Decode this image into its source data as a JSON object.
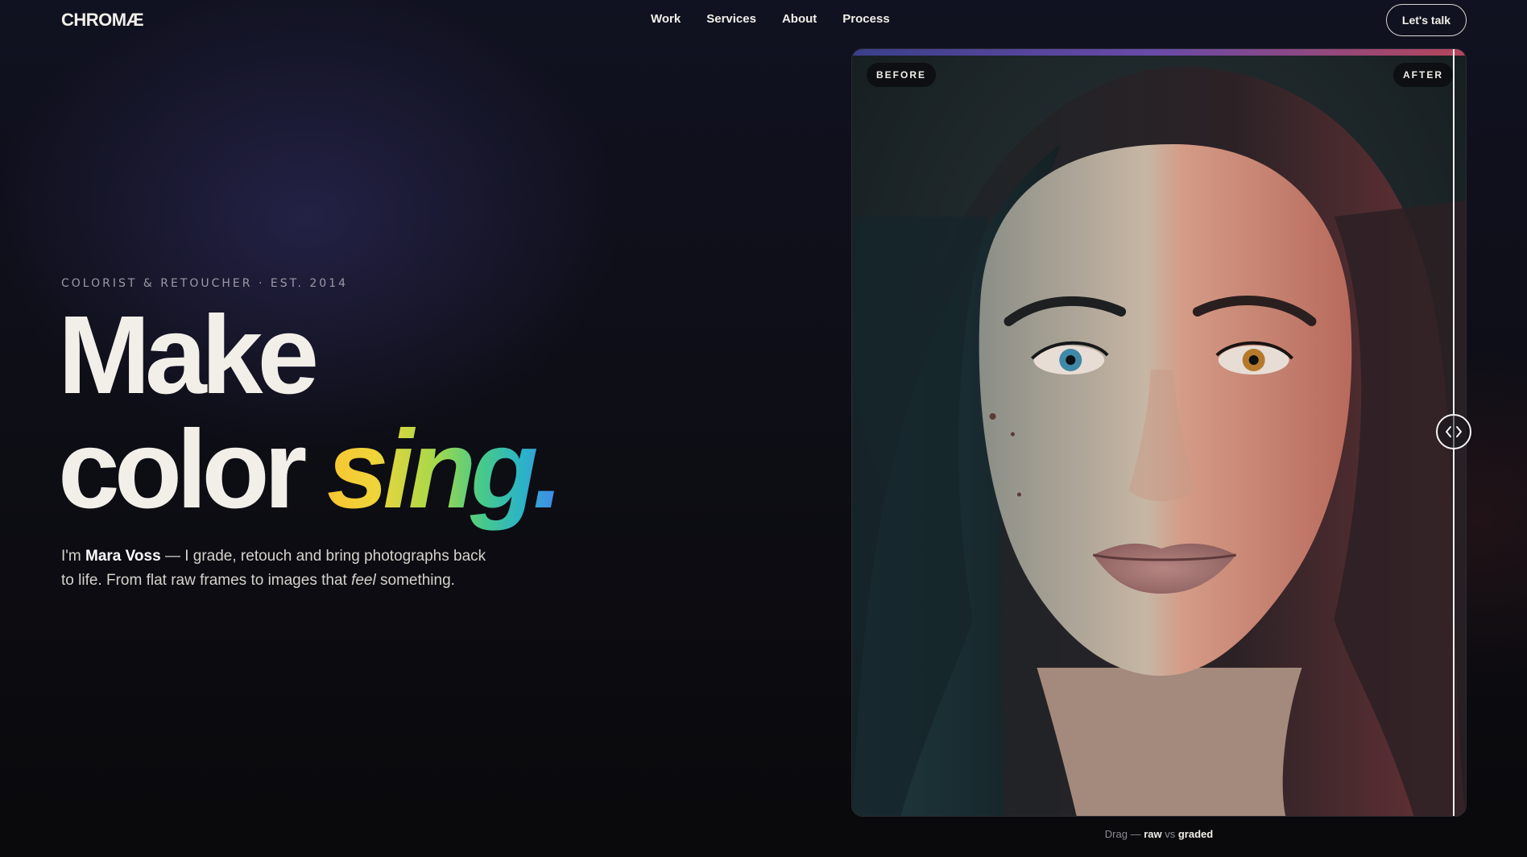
{
  "brand": {
    "logo": "CHROMÆ"
  },
  "nav": {
    "links": [
      "Work",
      "Services",
      "About",
      "Process"
    ],
    "cta_label": "Let's talk"
  },
  "hero": {
    "eyebrow": "COLORIST & RETOUCHER · EST. 2014",
    "headline_line1": "Make",
    "headline_line2_plain": "color",
    "headline_line2_accent": "sing.",
    "intro_prefix": "I'm",
    "intro_name": "Mara Voss",
    "intro_middle": "— I grade, retouch and bring photographs back to life. From flat raw frames to images that",
    "intro_emphasis": "feel",
    "intro_suffix": "something."
  },
  "compare": {
    "before_label": "BEFORE",
    "after_label": "AFTER",
    "caption_prefix": "Drag —",
    "caption_raw": "raw",
    "caption_vs": "vs",
    "caption_graded": "graded",
    "slider_position": 0.978,
    "gradient_colors": [
      "#3a3f8a",
      "#6a4aa8",
      "#b5465a"
    ]
  },
  "colors": {
    "background": "#0d0d14",
    "text": "#f2efe9",
    "accent_gradient": [
      "#f7c531",
      "#a6d94a",
      "#47c98a",
      "#2bb3c9",
      "#4a7cf0"
    ]
  },
  "icons": {
    "handle": "chevrons-left-right-icon"
  }
}
